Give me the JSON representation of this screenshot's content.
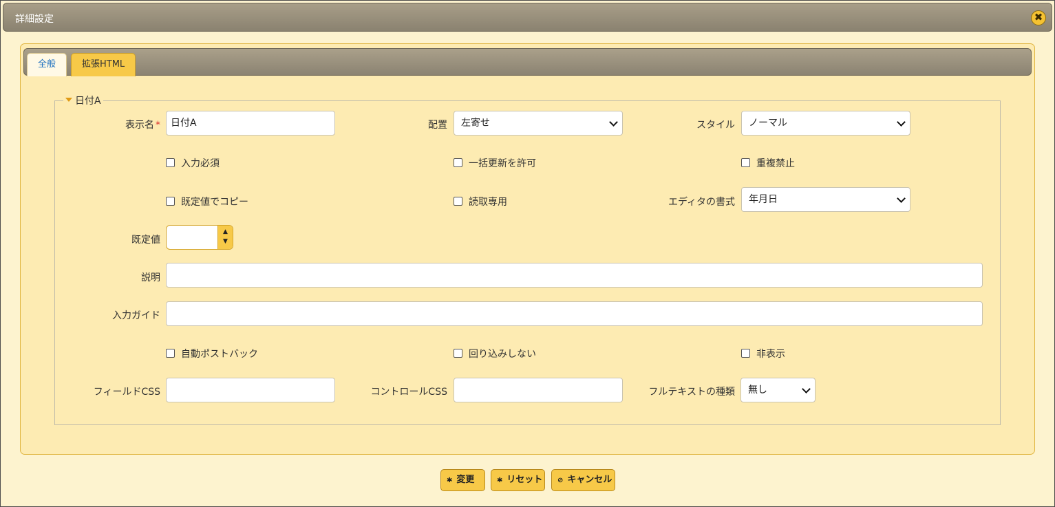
{
  "dialog": {
    "title": "詳細設定"
  },
  "tabs": [
    "全般",
    "拡張HTML"
  ],
  "group": {
    "legend": "日付A"
  },
  "fields": {
    "display_name_label": "表示名",
    "display_name_required_mark": "*",
    "display_name_value": "日付A",
    "align_label": "配置",
    "align_value": "左寄せ",
    "style_label": "スタイル",
    "style_value": "ノーマル",
    "editor_format_label": "エディタの書式",
    "editor_format_value": "年月日",
    "default_value_label": "既定値",
    "default_value": "",
    "description_label": "説明",
    "description_value": "",
    "input_guide_label": "入力ガイド",
    "input_guide_value": "",
    "field_css_label": "フィールドCSS",
    "field_css_value": "",
    "control_css_label": "コントロールCSS",
    "control_css_value": "",
    "fulltext_type_label": "フルテキストの種類",
    "fulltext_type_value": "無し"
  },
  "checkboxes": {
    "required": "入力必須",
    "bulk_update": "一括更新を許可",
    "no_duplicate": "重複禁止",
    "copy_default": "既定値でコピー",
    "read_only": "読取専用",
    "auto_postback": "自動ポストバック",
    "no_wrap": "回り込みしない",
    "hidden": "非表示"
  },
  "buttons": {
    "change": "変更",
    "reset": "リセット",
    "cancel": "キャンセル"
  },
  "colors": {
    "accent": "#f7c948",
    "panel_bg": "#fdebb2",
    "titlebar": "#9a917d",
    "active_tab_text": "#1b6fc0",
    "required_mark": "#d9302c"
  }
}
